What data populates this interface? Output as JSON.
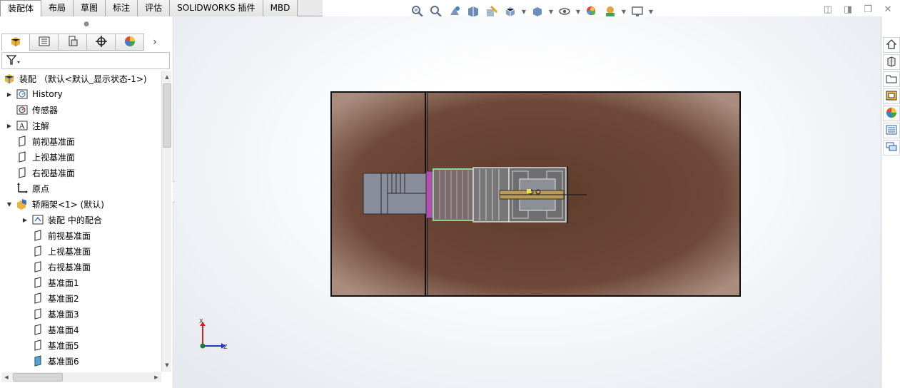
{
  "tabs": [
    {
      "label": "装配体",
      "active": true
    },
    {
      "label": "布局",
      "active": false
    },
    {
      "label": "草图",
      "active": false
    },
    {
      "label": "标注",
      "active": false
    },
    {
      "label": "评估",
      "active": false
    },
    {
      "label": "SOLIDWORKS 插件",
      "active": false
    },
    {
      "label": "MBD",
      "active": false
    }
  ],
  "heads_up_toolbar": {
    "icons": [
      "zoom-to-fit-icon",
      "zoom-to-area-icon",
      "previous-view-icon",
      "section-view-icon",
      "dynamic-annotation-icon",
      "view-orientation-icon",
      "display-style-icon",
      "hide-show-items-icon",
      "edit-appearance-icon",
      "apply-scene-icon",
      "view-settings-icon"
    ]
  },
  "feature_tree": {
    "panel_tabs": [
      "feature-manager-icon",
      "property-manager-icon",
      "configuration-manager-icon",
      "dimxpert-manager-icon",
      "display-manager-icon"
    ],
    "items": [
      {
        "label": "装配 （默认<默认_显示状态-1>)",
        "icon": "assembly-icon",
        "indent": 0,
        "expander": "none"
      },
      {
        "label": "History",
        "icon": "history-icon",
        "indent": 1,
        "expander": "collapsed"
      },
      {
        "label": "传感器",
        "icon": "sensor-icon",
        "indent": 1,
        "expander": "none"
      },
      {
        "label": "注解",
        "icon": "annotation-icon",
        "indent": 1,
        "expander": "collapsed"
      },
      {
        "label": "前视基准面",
        "icon": "plane-icon",
        "indent": 1,
        "expander": "none"
      },
      {
        "label": "上视基准面",
        "icon": "plane-icon",
        "indent": 1,
        "expander": "none"
      },
      {
        "label": "右视基准面",
        "icon": "plane-icon",
        "indent": 1,
        "expander": "none"
      },
      {
        "label": "原点",
        "icon": "origin-icon",
        "indent": 1,
        "expander": "none"
      },
      {
        "label": "轿厢架<1> (默认)",
        "icon": "subassembly-icon",
        "indent": 1,
        "expander": "expanded"
      },
      {
        "label": "装配 中的配合",
        "icon": "mates-icon",
        "indent": 2,
        "expander": "collapsed"
      },
      {
        "label": "前视基准面",
        "icon": "plane-icon",
        "indent": 2,
        "expander": "none"
      },
      {
        "label": "上视基准面",
        "icon": "plane-icon",
        "indent": 2,
        "expander": "none"
      },
      {
        "label": "右视基准面",
        "icon": "plane-icon",
        "indent": 2,
        "expander": "none"
      },
      {
        "label": "基准面1",
        "icon": "plane-icon",
        "indent": 2,
        "expander": "none"
      },
      {
        "label": "基准面2",
        "icon": "plane-icon",
        "indent": 2,
        "expander": "none"
      },
      {
        "label": "基准面3",
        "icon": "plane-icon",
        "indent": 2,
        "expander": "none"
      },
      {
        "label": "基准面4",
        "icon": "plane-icon",
        "indent": 2,
        "expander": "none"
      },
      {
        "label": "基准面5",
        "icon": "plane-icon",
        "indent": 2,
        "expander": "none"
      },
      {
        "label": "基准面6",
        "icon": "plane-filled-icon",
        "indent": 2,
        "expander": "none"
      }
    ]
  },
  "triad": {
    "x_label": "X",
    "z_label": "Z"
  },
  "task_pane": {
    "icons": [
      "home-icon",
      "design-library-icon",
      "file-explorer-icon",
      "view-palette-icon",
      "appearances-icon",
      "custom-properties-icon",
      "forum-icon"
    ]
  },
  "colors": {
    "floor": "#6b4634",
    "floor_edge": "#a08576",
    "accent_magenta": "#b04fb0",
    "accent_green": "#8bd48b",
    "machine_gray": "#8a8d9c"
  }
}
